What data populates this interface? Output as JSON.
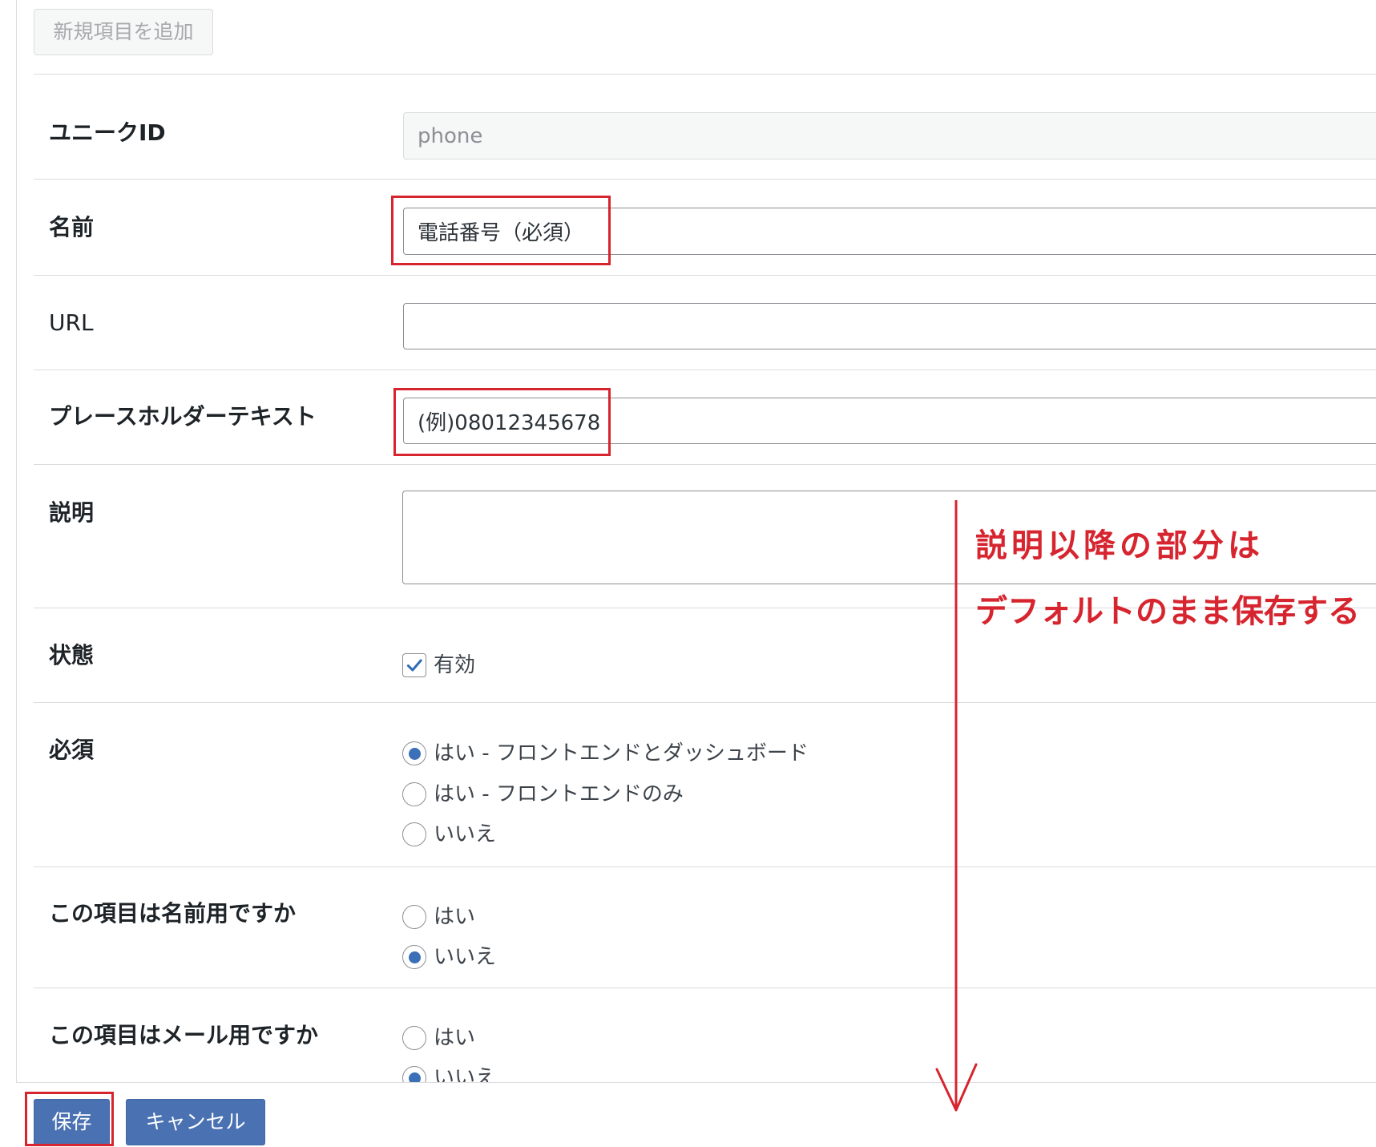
{
  "toolbar": {
    "add_item_label": "新規項目を追加"
  },
  "fields": {
    "unique_id": {
      "label": "ユニークID",
      "value": "phone"
    },
    "name": {
      "label": "名前",
      "value": "電話番号（必須）"
    },
    "url": {
      "label": "URL"
    },
    "placeholder": {
      "label": "プレースホルダーテキスト",
      "value": "(例)08012345678"
    },
    "description": {
      "label": "説明"
    },
    "status": {
      "label": "状態",
      "checkbox_label": "有効",
      "checked": true
    },
    "required": {
      "label": "必須",
      "options": [
        {
          "label": "はい - フロントエンドとダッシュボード",
          "checked": true
        },
        {
          "label": "はい - フロントエンドのみ",
          "checked": false
        },
        {
          "label": "いいえ",
          "checked": false
        }
      ]
    },
    "is_name_field": {
      "label": "この項目は名前用ですか",
      "options": [
        {
          "label": "はい",
          "checked": false
        },
        {
          "label": "いいえ",
          "checked": true
        }
      ]
    },
    "is_email_field": {
      "label": "この項目はメール用ですか",
      "options": [
        {
          "label": "はい",
          "checked": false
        },
        {
          "label": "いいえ",
          "checked": true
        }
      ]
    }
  },
  "footer": {
    "save_label": "保存",
    "cancel_label": "キャンセル"
  },
  "annotation": {
    "lines": [
      "説明以降の部分は",
      "デフォルトのまま保存する"
    ]
  },
  "icons": {
    "status_checkbox": "checkmark-icon",
    "annotation_arrow": "arrow-down-icon"
  },
  "colors": {
    "accent": "#4a72b2",
    "highlight_red": "#d7252f",
    "control_blue": "#3b6fb6"
  }
}
